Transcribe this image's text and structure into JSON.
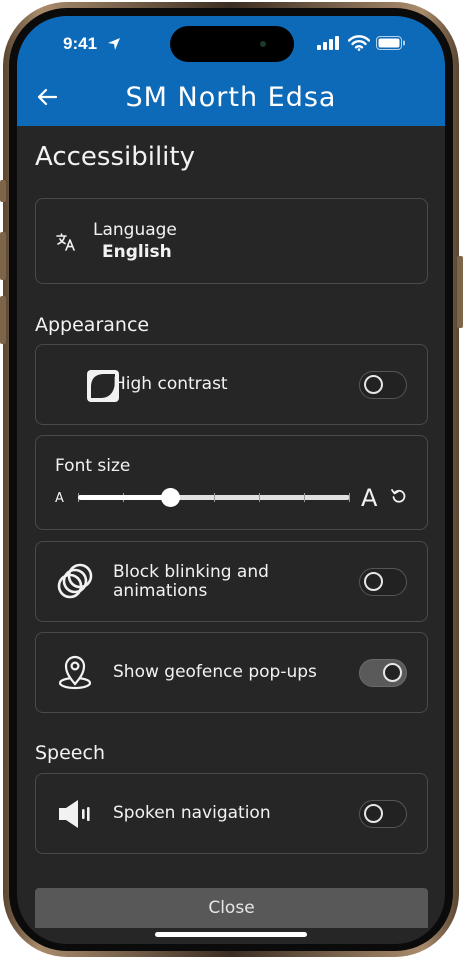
{
  "status_bar": {
    "time": "9:41"
  },
  "header": {
    "title": "SM North Edsa"
  },
  "page": {
    "title": "Accessibility"
  },
  "language": {
    "label": "Language",
    "value": "English"
  },
  "sections": {
    "appearance": "Appearance",
    "speech": "Speech"
  },
  "settings": {
    "high_contrast": {
      "label": "High contrast",
      "enabled": false
    },
    "font_size": {
      "label": "Font size",
      "small_glyph": "A",
      "large_glyph": "A",
      "level_fraction": 0.34,
      "ticks": 7
    },
    "block_blinking": {
      "label_line1": "Block blinking and",
      "label_line2": "animations",
      "enabled": false
    },
    "geofence": {
      "label": "Show geofence pop-ups",
      "enabled": true
    },
    "spoken_navigation": {
      "label": "Spoken navigation",
      "enabled": false
    }
  },
  "footer": {
    "close_label": "Close"
  },
  "colors": {
    "header_blue": "#0d6ab8",
    "screen_bg": "#262626"
  },
  "icons": [
    "back-arrow-icon",
    "translate-icon",
    "contrast-icon",
    "reset-icon",
    "rings-icon",
    "geofence-pin-icon",
    "speaker-icon",
    "signal-icon",
    "wifi-icon",
    "battery-icon",
    "location-arrow-icon"
  ]
}
